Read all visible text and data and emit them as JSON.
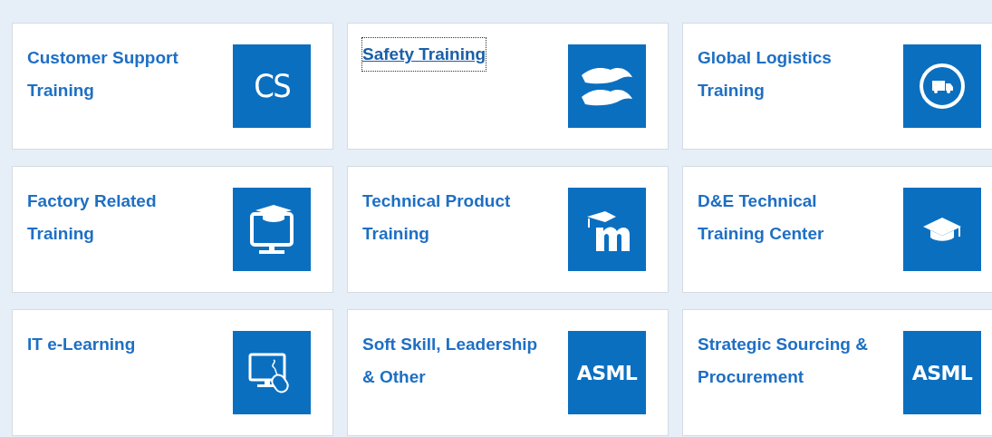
{
  "courses": [
    {
      "title": "Customer Support Training",
      "focused": false,
      "tile": {
        "kind": "text",
        "label": "CS"
      }
    },
    {
      "title": "Safety Training",
      "focused": true,
      "tile": {
        "kind": "hands"
      }
    },
    {
      "title": "Global Logistics Training",
      "focused": false,
      "tile": {
        "kind": "truck"
      }
    },
    {
      "title": "Factory Related Training",
      "focused": false,
      "tile": {
        "kind": "monitor-cap"
      }
    },
    {
      "title": "Technical Product Training",
      "focused": false,
      "tile": {
        "kind": "m-cap"
      }
    },
    {
      "title": "D&E Technical Training Center",
      "focused": false,
      "tile": {
        "kind": "cap"
      }
    },
    {
      "title": "IT e-Learning",
      "focused": false,
      "tile": {
        "kind": "monitor-mouse"
      }
    },
    {
      "title": "Soft Skill, Leadership & Other",
      "focused": false,
      "tile": {
        "kind": "text",
        "label": "ASML"
      }
    },
    {
      "title": "Strategic Sourcing & Procurement",
      "focused": false,
      "tile": {
        "kind": "text",
        "label": "ASML"
      }
    }
  ]
}
